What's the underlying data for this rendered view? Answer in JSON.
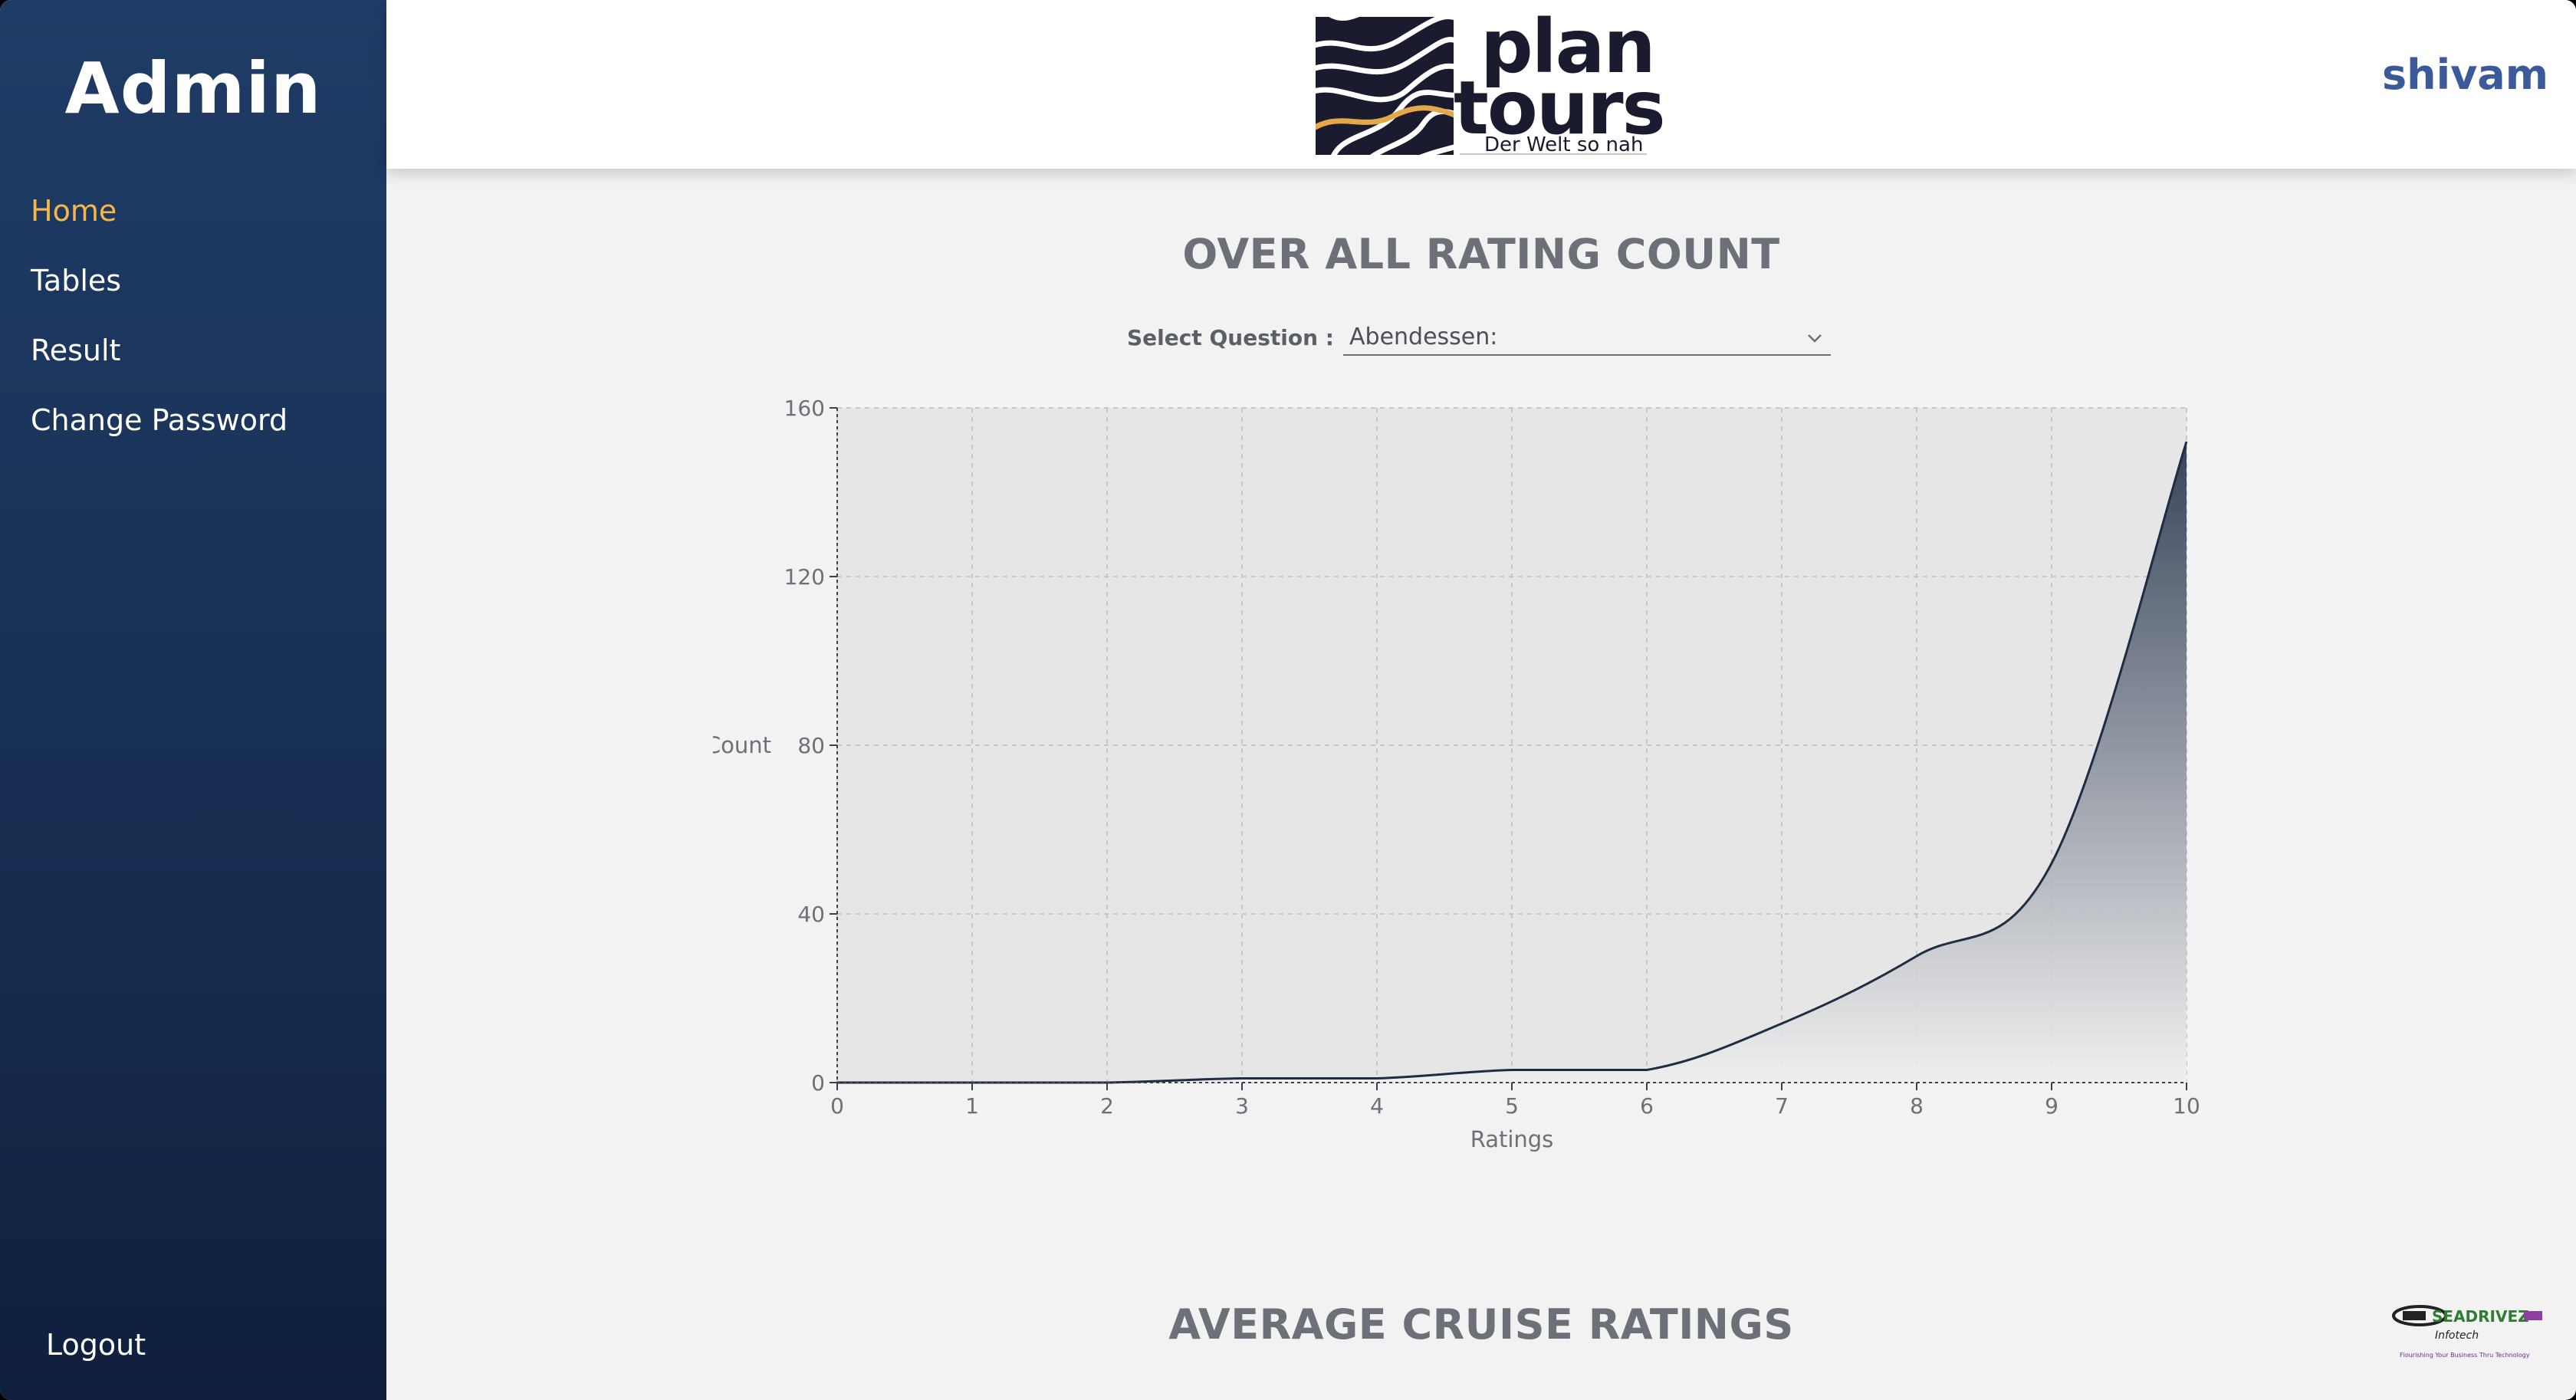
{
  "sidebar": {
    "title": "Admin",
    "items": [
      {
        "label": "Home",
        "active": true
      },
      {
        "label": "Tables",
        "active": false
      },
      {
        "label": "Result",
        "active": false
      },
      {
        "label": "Change Password",
        "active": false
      }
    ],
    "logout_label": "Logout"
  },
  "header": {
    "brand": {
      "word1": "plan",
      "word2": "tours",
      "tagline": "Der Welt so nah"
    },
    "user_name": "shivam"
  },
  "main": {
    "rating_section_title": "OVER ALL RATING COUNT",
    "select_label": "Select Question :",
    "select_value": "Abendessen:",
    "average_section_title": "AVERAGE CRUISE RATINGS"
  },
  "chart_data": {
    "type": "area",
    "title": "",
    "xlabel": "Ratings",
    "ylabel": "Count",
    "x": [
      0,
      1,
      2,
      3,
      4,
      5,
      6,
      7,
      8,
      9,
      10
    ],
    "values": [
      0,
      0,
      0,
      1,
      1,
      3,
      3,
      14,
      30,
      52,
      152
    ],
    "xlim": [
      0,
      10
    ],
    "ylim": [
      0,
      160
    ],
    "yticks": [
      0,
      40,
      80,
      120,
      160
    ],
    "xticks": [
      0,
      1,
      2,
      3,
      4,
      5,
      6,
      7,
      8,
      9,
      10
    ],
    "grid": true,
    "line_color": "#1f2d44",
    "fill_color_top": "#2e3b52",
    "fill_color_bottom": "#f0f0f0",
    "plot_background": "#e6e6e6"
  },
  "footer": {
    "logo_name": "SEADRIVEZ",
    "logo_sub": "Infotech",
    "logo_tagline": "Flourishing Your Business Thru Technology"
  },
  "colors": {
    "sidebar_top": "#1f3c66",
    "sidebar_bottom": "#0f1f3d",
    "active_nav": "#f5b64a",
    "user_name": "#3a5a9a",
    "section_title": "#6b7079"
  }
}
